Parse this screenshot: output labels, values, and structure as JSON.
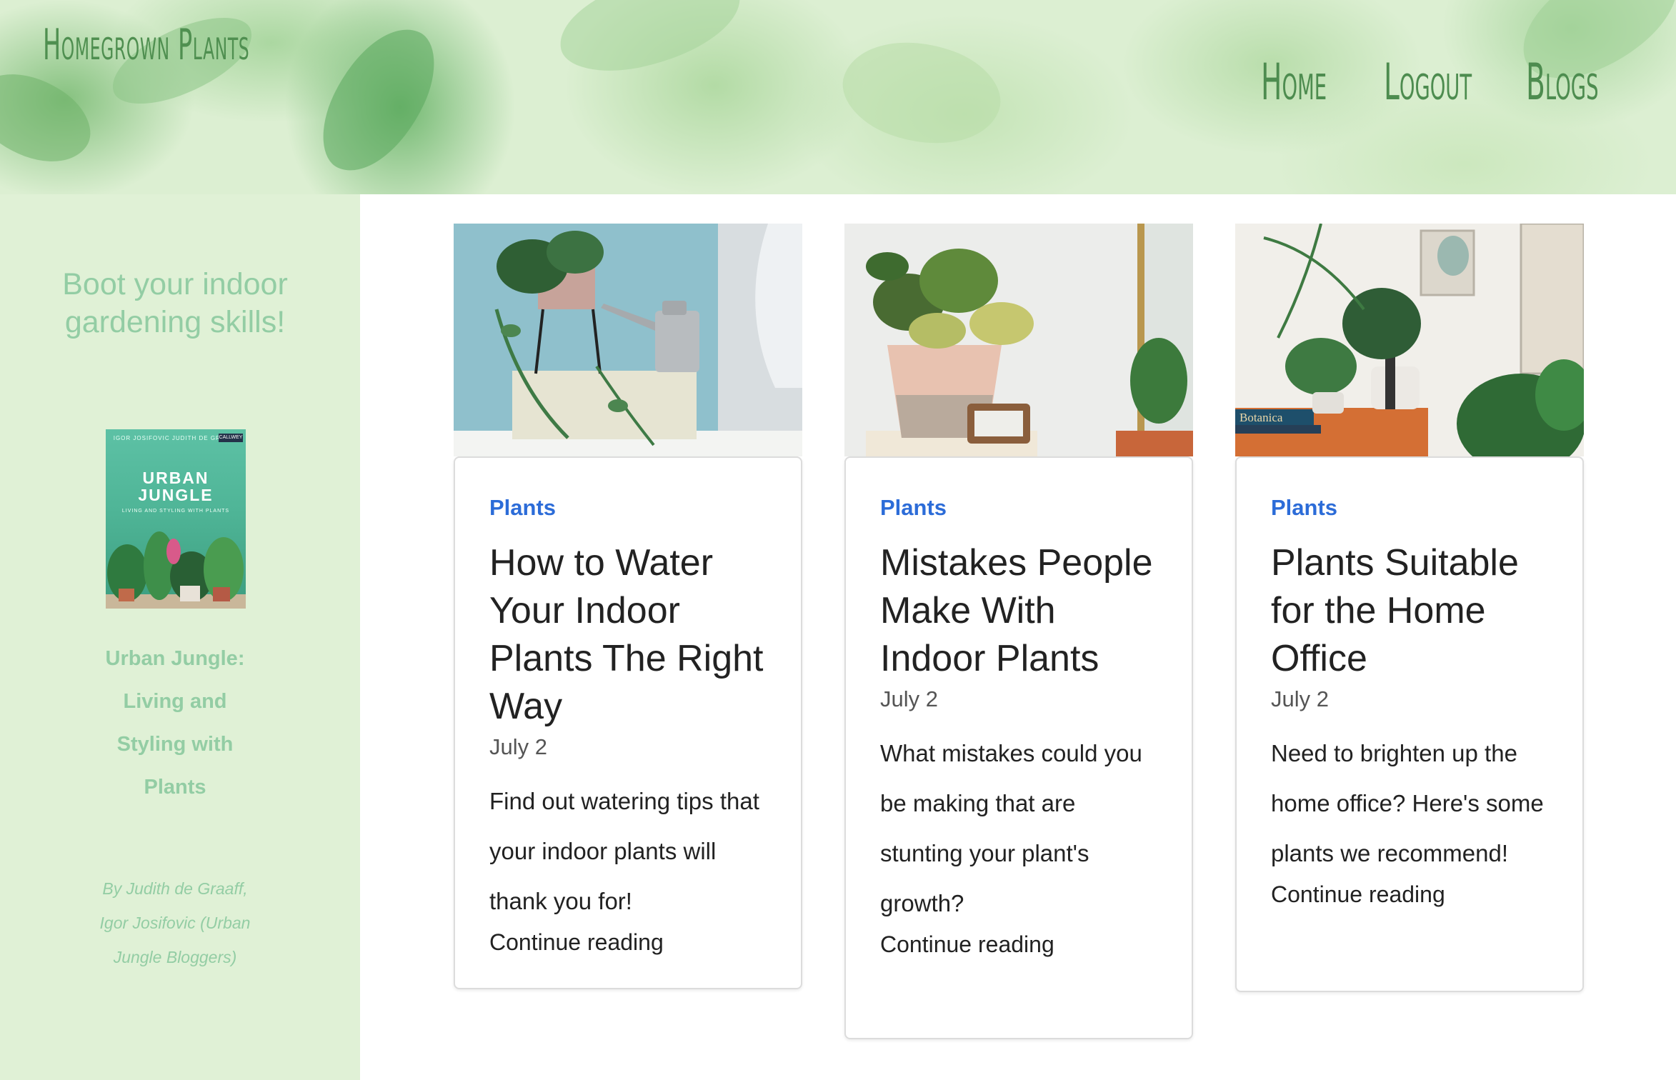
{
  "site": {
    "title": "Homegrown Plants"
  },
  "nav": {
    "items": [
      {
        "label": "Home"
      },
      {
        "label": "Logout"
      },
      {
        "label": "Blogs"
      }
    ]
  },
  "sidebar": {
    "heading": "Boot your indoor gardening skills!",
    "book": {
      "name": "Urban Jungle: Living and Styling with Plants",
      "author": "By Judith de Graaff, Igor Josifovic (Urban Jungle Bloggers)",
      "cover_top": "IGOR JOSIFOVIC JUDITH DE GRAAFF",
      "cover_publisher": "CALLWEY",
      "cover_title": "URBAN JUNGLE",
      "cover_subtitle": "LIVING AND STYLING WITH PLANTS"
    }
  },
  "posts": [
    {
      "category": "Plants",
      "title": "How to Water Your Indoor Plants The Right Way",
      "date": "July 2",
      "excerpt": "Find out watering tips that your indoor plants will thank you for!",
      "more": "Continue reading"
    },
    {
      "category": "Plants",
      "title": "Mistakes People Make With Indoor Plants",
      "date": "July 2",
      "excerpt": "What mistakes could you be making that are stunting your plant's growth?",
      "more": "Continue reading"
    },
    {
      "category": "Plants",
      "title": "Plants Suitable for the Home Office",
      "date": "July 2",
      "excerpt": "Need to brighten up the home office? Here's some plants we recommend!",
      "more": "Continue reading",
      "image_label": "Botanica"
    }
  ],
  "colors": {
    "header_bg": "#dcefd2",
    "sidebar_bg": "#e0f1d6",
    "sidebar_text": "#93cda4",
    "nav_text": "#4d8c4f",
    "category_link": "#2c6cd8"
  }
}
